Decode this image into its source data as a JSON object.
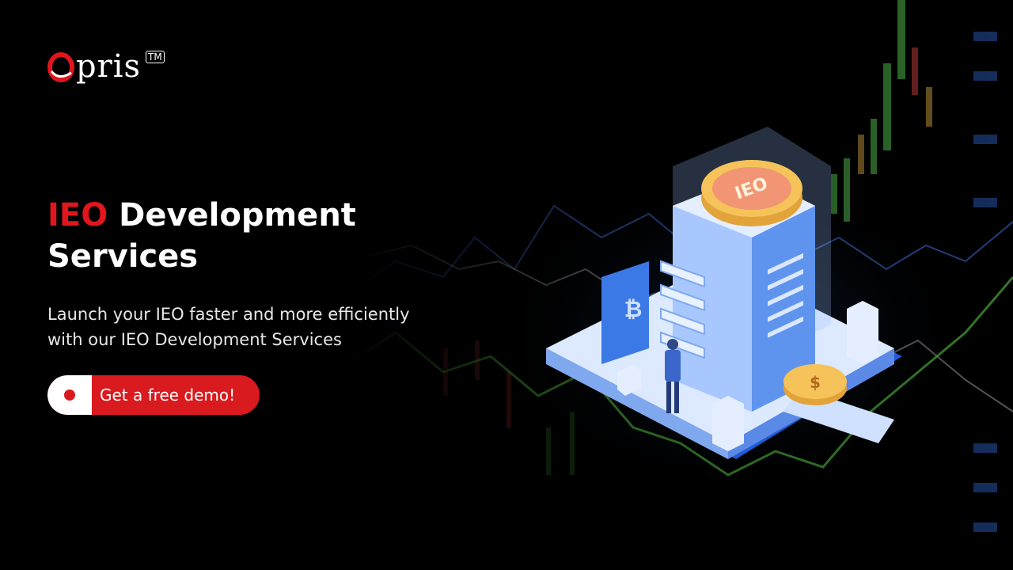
{
  "brand": {
    "name": "pris",
    "trademark": "TM"
  },
  "hero": {
    "title_accent": "IEO",
    "title_rest": " Development",
    "title_line2": "Services",
    "subtitle_line1": "Launch your IEO faster and more efficiently",
    "subtitle_line2": "with our IEO Development Services"
  },
  "cta": {
    "label": "Get a free demo!"
  },
  "illustration": {
    "coin_label": "IEO",
    "icon_names": [
      "bitcoin-icon",
      "dollar-coin-icon",
      "ieo-coin-icon"
    ]
  },
  "colors": {
    "accent": "#e1161d",
    "background": "#000000",
    "illustration_blue": "#4a8ff0"
  }
}
